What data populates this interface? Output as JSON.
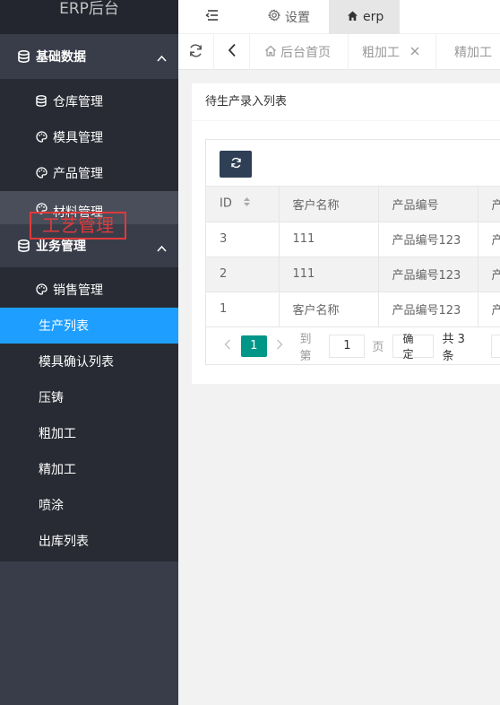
{
  "app": {
    "title": "ERP后台"
  },
  "sidebar": {
    "groups": [
      {
        "label": "基础数据",
        "items": [
          {
            "label": "仓库管理",
            "icon": "database-icon"
          },
          {
            "label": "模具管理",
            "icon": "palette-icon"
          },
          {
            "label": "产品管理",
            "icon": "palette-icon"
          },
          {
            "label": "材料管理",
            "icon": "palette-icon"
          }
        ]
      },
      {
        "label": "业务管理",
        "items": [
          {
            "label": "销售管理",
            "icon": "palette-icon"
          },
          {
            "label": "生产列表"
          },
          {
            "label": "模具确认列表"
          },
          {
            "label": "压铸"
          },
          {
            "label": "粗加工"
          },
          {
            "label": "精加工"
          },
          {
            "label": "喷涂"
          },
          {
            "label": "出库列表"
          }
        ]
      }
    ],
    "active_item": "生产列表",
    "overlay_label": "工艺管理"
  },
  "topbar": {
    "settings_label": "设置",
    "user_label": "erp"
  },
  "tabs": [
    {
      "label": "后台首页"
    },
    {
      "label": "粗加工",
      "closable": true
    },
    {
      "label": "精加工"
    }
  ],
  "panel": {
    "title": "待生产录入列表",
    "table": {
      "columns": [
        "ID",
        "客户名称",
        "产品编号",
        "产"
      ],
      "rows": [
        [
          "3",
          "111",
          "产品编号123",
          "产"
        ],
        [
          "2",
          "111",
          "产品编号123",
          "产"
        ],
        [
          "1",
          "客户名称",
          "产品编号123",
          "产"
        ]
      ]
    },
    "pager": {
      "current_page": "1",
      "goto_label": "到第",
      "goto_value": "1",
      "page_unit": "页",
      "confirm_label": "确定",
      "total_label": "共 3 条"
    }
  },
  "colors": {
    "sidebar_bg": "#393d49",
    "sidebar_sub_bg": "#282b33",
    "active_blue": "#1e9fff",
    "pager_green": "#009688",
    "toolbar_btn": "#2f4056",
    "overlay_red": "#e03a3a"
  }
}
